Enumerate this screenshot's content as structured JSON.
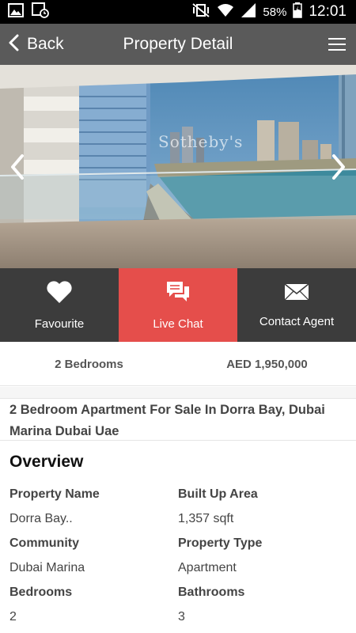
{
  "status_bar": {
    "battery_percent": "58%",
    "time": "12:01"
  },
  "header": {
    "back_label": "Back",
    "title": "Property Detail"
  },
  "hero": {
    "watermark": "Sotheby's"
  },
  "actions": [
    {
      "label": "Favourite",
      "icon": "heart-icon"
    },
    {
      "label": "Live Chat",
      "icon": "chat-bubbles-icon"
    },
    {
      "label": "Contact Agent",
      "icon": "envelope-icon"
    }
  ],
  "info": {
    "bedrooms": "2 Bedrooms",
    "price": "AED 1,950,000"
  },
  "property_title": "2 Bedroom Apartment For Sale In Dorra Bay, Dubai Marina Dubai Uae",
  "overview": {
    "heading": "Overview",
    "fields": [
      {
        "label": "Property Name",
        "value": "Dorra Bay.."
      },
      {
        "label": "Built Up Area",
        "value": "1,357 sqft"
      },
      {
        "label": "Community",
        "value": "Dubai Marina"
      },
      {
        "label": "Property Type",
        "value": "Apartment"
      },
      {
        "label": "Bedrooms",
        "value": "2"
      },
      {
        "label": "Bathrooms",
        "value": "3"
      }
    ]
  },
  "colors": {
    "header_bg": "#5a5a5a",
    "action_dark": "#3c3c3c",
    "action_accent": "#e54e4b"
  }
}
